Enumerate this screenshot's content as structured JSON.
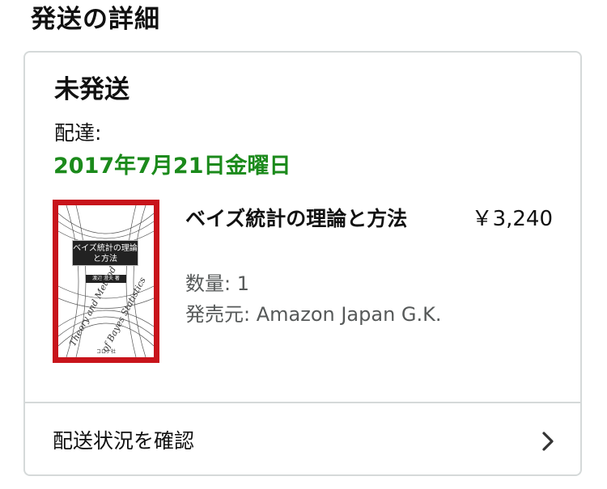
{
  "page": {
    "title": "発送の詳細"
  },
  "shipment": {
    "status": "未発送",
    "delivery_label": "配達:",
    "delivery_date": "2017年7月21日金曜日",
    "date_color": "#1b8a1b"
  },
  "product": {
    "title": "ベイズ統計の理論と方法",
    "price": "￥3,240",
    "quantity": "数量: 1",
    "seller": "発売元: Amazon Japan G.K.",
    "cover": {
      "title_text": "ベイズ統計の理論と方法",
      "author_text": "渡辺 澄夫 著",
      "publisher_text": "コロナ社",
      "accent_color": "#c8141b"
    }
  },
  "actions": {
    "track_label": "配送状況を確認",
    "track_icon": "chevron-right-icon"
  }
}
